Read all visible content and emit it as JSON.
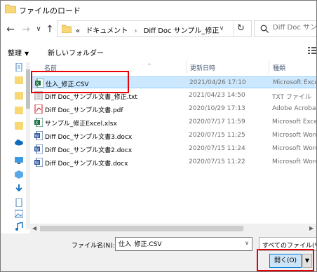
{
  "window": {
    "title": "ファイルのロード"
  },
  "nav": {
    "back": "←",
    "forward": "→",
    "recent": "∨",
    "up": "↑"
  },
  "address": {
    "overflow": "«",
    "crumbs": [
      "ドキュメント",
      "Diff Doc サンプル_修正"
    ],
    "separator": "›",
    "dropdown": "∨",
    "refresh": "↻"
  },
  "search": {
    "placeholder": "Diff Doc サンプル"
  },
  "toolbar": {
    "organize_label": "整理",
    "organize_caret": "▼",
    "new_folder_label": "新しいフォルダー"
  },
  "columns": {
    "name": "名前",
    "date": "更新日時",
    "type": "種類",
    "sort_indicator": "^"
  },
  "files": [
    {
      "name": "仕入_修正.CSV",
      "date": "2021/04/26 17:10",
      "type": "Microsoft Excel",
      "icon": "excel-csv-icon",
      "selected": true
    },
    {
      "name": "Diff Doc_サンプル文書_修正.txt",
      "date": "2021/04/23 14:50",
      "type": "TXT ファイル",
      "icon": "text-file-icon",
      "selected": false
    },
    {
      "name": "Diff Doc_サンプル文書.pdf",
      "date": "2020/10/29 17:13",
      "type": "Adobe Acrobat",
      "icon": "pdf-icon",
      "selected": false
    },
    {
      "name": "サンプル_修正Excel.xlsx",
      "date": "2020/07/17 11:59",
      "type": "Microsoft Excel",
      "icon": "excel-icon",
      "selected": false
    },
    {
      "name": "Diff Doc_サンプル文書3.docx",
      "date": "2020/07/15 11:25",
      "type": "Microsoft Word",
      "icon": "word-icon",
      "selected": false
    },
    {
      "name": "Diff Doc_サンプル文書2.docx",
      "date": "2020/07/15 11:24",
      "type": "Microsoft Word",
      "icon": "word-icon",
      "selected": false
    },
    {
      "name": "Diff Doc_サンプル文書.docx",
      "date": "2020/07/15 11:22",
      "type": "Microsoft Word",
      "icon": "word-icon",
      "selected": false
    }
  ],
  "scroll": {
    "left": "◀",
    "right": "▶"
  },
  "bottom": {
    "filename_label": "ファイル名(N):",
    "filename_value": "仕入_修正.CSV",
    "filename_caret": "∨",
    "filter_label": "すべてのファイル(*.*)",
    "open_label": "開く(O)",
    "open_caret": "▼"
  },
  "colors": {
    "highlight": "#e8000a",
    "selection": "#cce8ff",
    "accent": "#0078d7",
    "folder": "#f8d775"
  }
}
